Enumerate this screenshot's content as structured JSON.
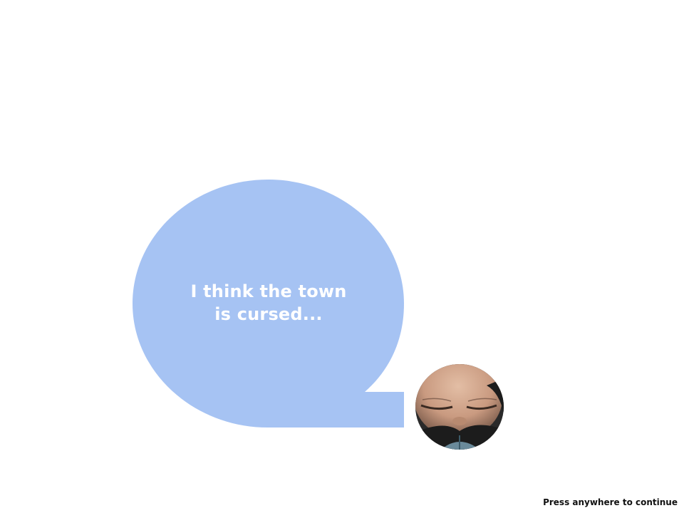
{
  "dialogue": {
    "lines": [
      "I think the town",
      "is cursed..."
    ],
    "bubble_color": "#a6c3f3",
    "text_color": "#ffffff"
  },
  "speaker": {
    "avatar_icon": "smiling-face-portrait-icon"
  },
  "hint": {
    "continue_label": "Press anywhere to continue"
  }
}
